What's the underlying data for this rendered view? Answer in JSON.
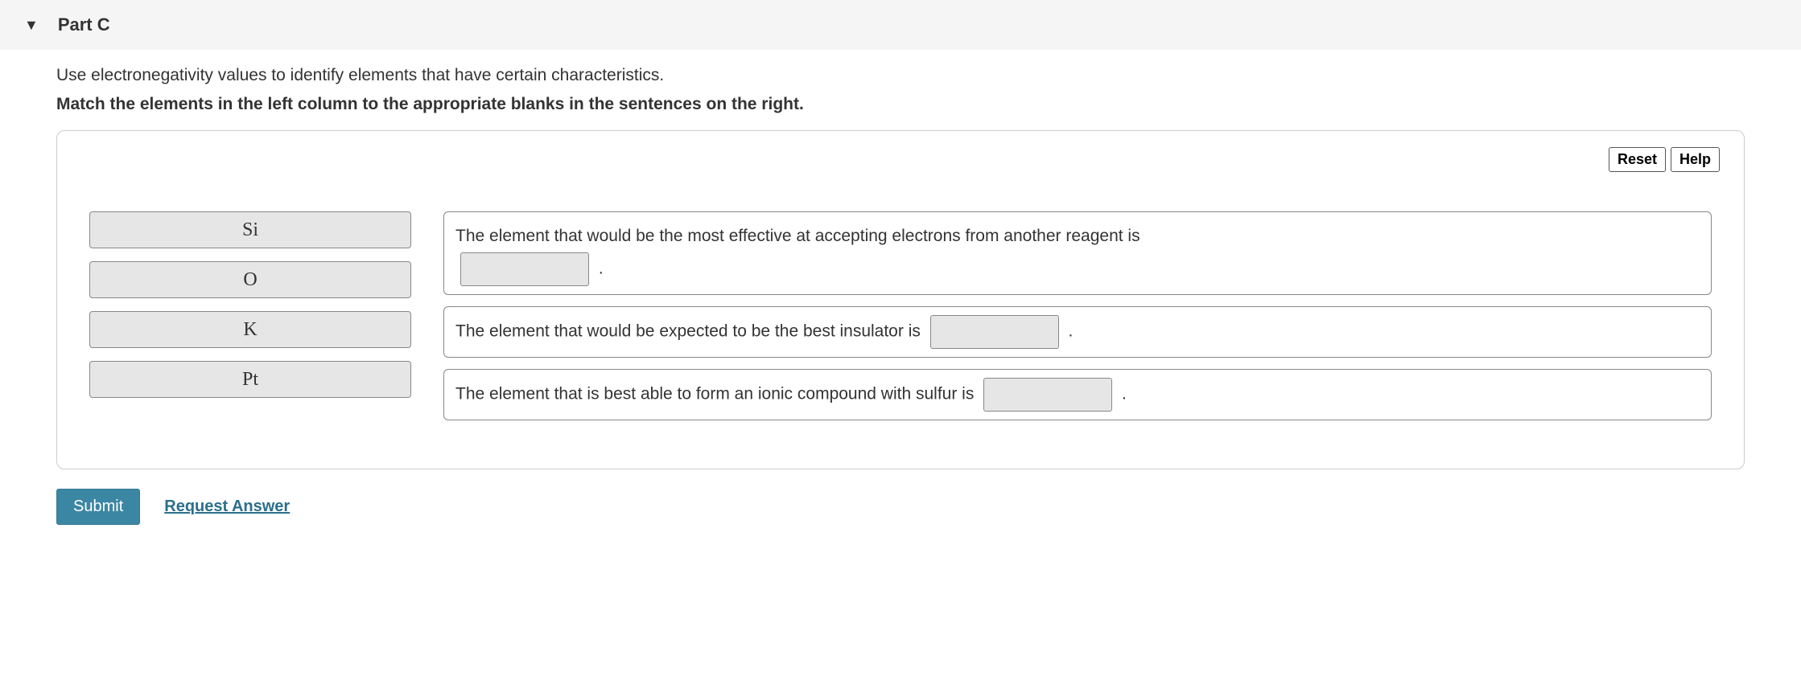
{
  "header": {
    "title": "Part C"
  },
  "intro_text": "Use electronegativity values to identify elements that have certain characteristics.",
  "instruction_text": "Match the elements in the left column to the appropriate blanks in the sentences on the right.",
  "buttons": {
    "reset": "Reset",
    "help": "Help",
    "submit": "Submit",
    "request_answer": "Request Answer"
  },
  "elements": [
    "Si",
    "O",
    "K",
    "Pt"
  ],
  "sentences": [
    {
      "before": "The element that would be the most effective at accepting electrons from another reagent is",
      "after": "."
    },
    {
      "before": "The element that would be expected to be the best insulator is",
      "after": "."
    },
    {
      "before": "The element that is best able to form an ionic compound with sulfur is",
      "after": "."
    }
  ]
}
